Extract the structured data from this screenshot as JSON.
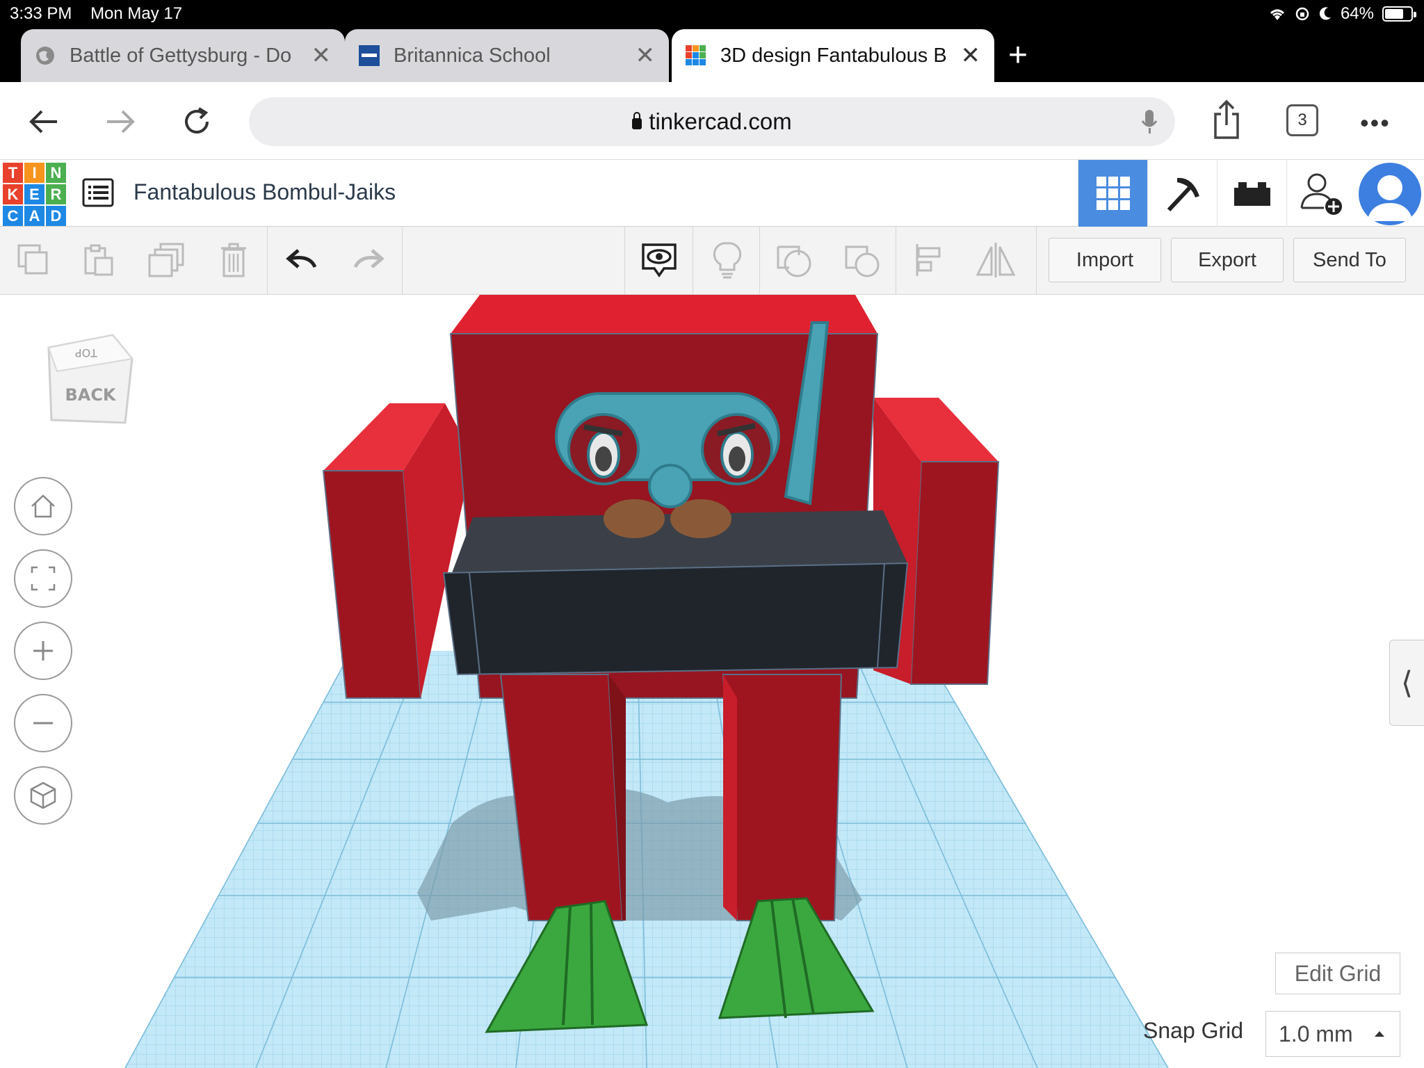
{
  "status": {
    "time": "3:33 PM",
    "date": "Mon May 17",
    "battery": "64%"
  },
  "tabs": [
    {
      "title": "Battle of Gettysburg - Do",
      "active": false
    },
    {
      "title": "Britannica School",
      "active": false
    },
    {
      "title": "3D design Fantabulous B",
      "active": true
    }
  ],
  "address": {
    "url": "tinkercad.com",
    "tab_count": "3"
  },
  "app": {
    "logo_letters": [
      "T",
      "I",
      "N",
      "K",
      "E",
      "R",
      "C",
      "A",
      "D"
    ],
    "logo_colors": [
      "#e8412c",
      "#f7941d",
      "#4caf50",
      "#e8412c",
      "#1e88e5",
      "#4caf50",
      "#1e88e5",
      "#1e88e5",
      "#1e88e5"
    ],
    "design_title": "Fantabulous Bombul-Jaiks",
    "header_buttons": [
      "grid-view-icon",
      "pickaxe-icon",
      "bricks-icon",
      "add-user-icon"
    ]
  },
  "toolbar": {
    "import_label": "Import",
    "export_label": "Export",
    "send_to_label": "Send To"
  },
  "viewcube": {
    "top_label": "TOP",
    "back_label": "BACK"
  },
  "grid": {
    "edit_grid_label": "Edit Grid",
    "snap_grid_label": "Snap Grid",
    "snap_grid_value": "1.0 mm"
  },
  "colors": {
    "accent": "#4a8ce0",
    "workplane": "#bfe6f5",
    "robot_red": "#d71f2c",
    "belt": "#22272e",
    "goggles": "#4aa3b5",
    "flippers": "#3aa83f"
  }
}
